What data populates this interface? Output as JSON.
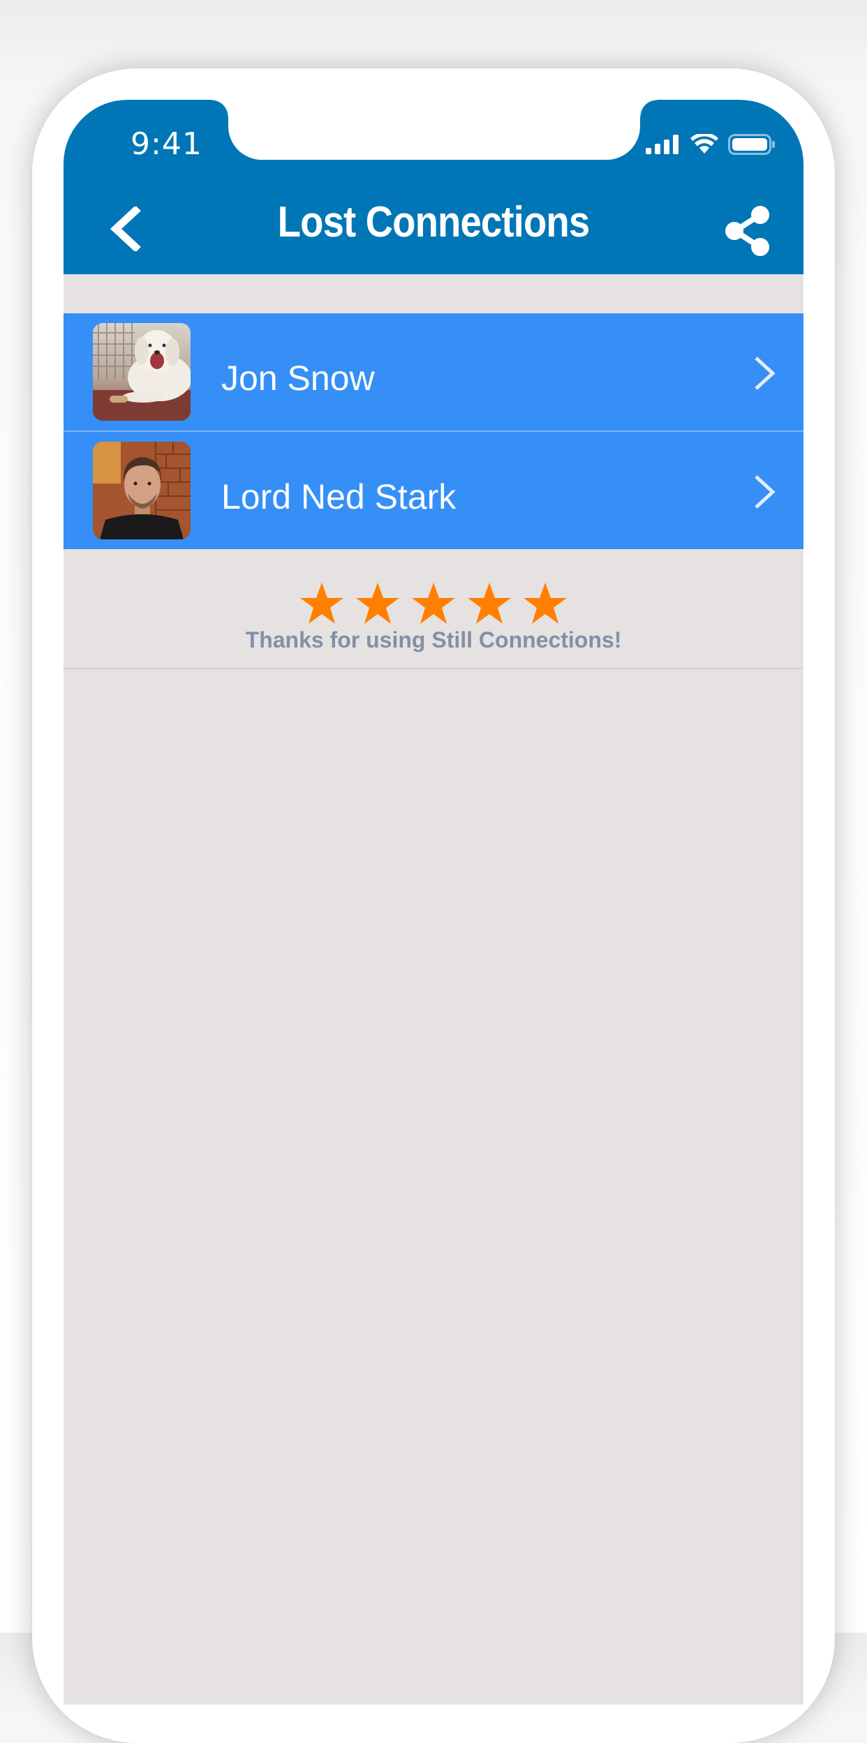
{
  "status_bar": {
    "time": "9:41"
  },
  "nav": {
    "title": "Lost Connections",
    "back_icon": "chevron-left-icon",
    "share_icon": "share-icon"
  },
  "connections": [
    {
      "name": "Jon Snow",
      "avatar": "dog-photo"
    },
    {
      "name": "Lord Ned Stark",
      "avatar": "man-photo"
    }
  ],
  "rating": {
    "stars": 5,
    "message": "Thanks for using Still Connections!"
  },
  "colors": {
    "header": "#0076b6",
    "row": "#358ff7",
    "background": "#e6e2e2",
    "star": "#ff7f00",
    "footer_text": "#8290a6"
  }
}
